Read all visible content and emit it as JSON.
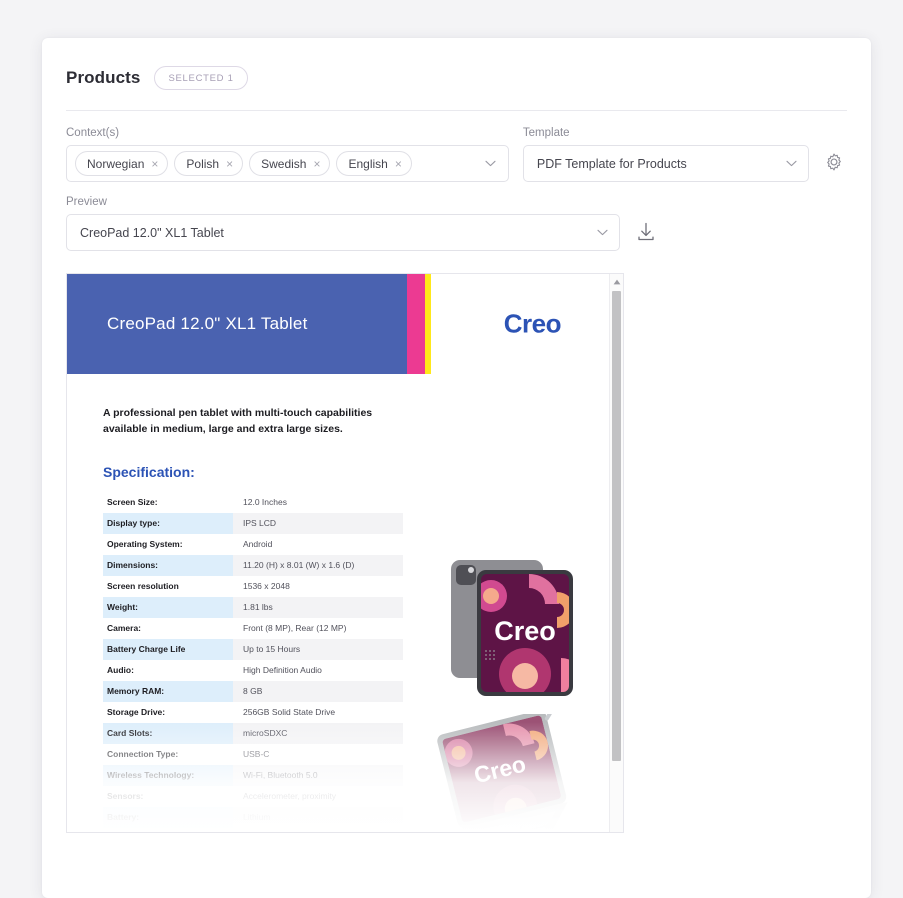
{
  "header": {
    "title": "Products",
    "badge": "SELECTED 1"
  },
  "form": {
    "contexts_label": "Context(s)",
    "context_chips": [
      {
        "label": "Norwegian",
        "remove_icon": "×"
      },
      {
        "label": "Polish",
        "remove_icon": "×"
      },
      {
        "label": "Swedish",
        "remove_icon": "×"
      },
      {
        "label": "English",
        "remove_icon": "×"
      }
    ],
    "template_label": "Template",
    "template_value": "PDF Template for Products",
    "preview_label": "Preview",
    "preview_value": "CreoPad 12.0\" XL1 Tablet"
  },
  "document": {
    "banner_title": "CreoPad 12.0\" XL1 Tablet",
    "brand": "Creo",
    "description": "A professional pen tablet with multi-touch capabilities available in medium, large and extra large sizes.",
    "spec_title": "Specification:",
    "specs": [
      {
        "key": "Screen Size:",
        "value": "12.0 Inches"
      },
      {
        "key": "Display type:",
        "value": "IPS LCD"
      },
      {
        "key": "Operating System:",
        "value": "Android"
      },
      {
        "key": "Dimensions:",
        "value": "11.20 (H) x 8.01 (W) x 1.6 (D)"
      },
      {
        "key": "Screen resolution",
        "value": "1536 x 2048"
      },
      {
        "key": "Weight:",
        "value": "1.81 lbs"
      },
      {
        "key": "Camera:",
        "value": "Front (8 MP), Rear (12 MP)"
      },
      {
        "key": "Battery Charge Life",
        "value": "Up to 15 Hours"
      },
      {
        "key": "Audio:",
        "value": "High Definition Audio"
      },
      {
        "key": "Memory RAM:",
        "value": "8 GB"
      },
      {
        "key": "Storage Drive:",
        "value": "256GB Solid State Drive"
      },
      {
        "key": "Card Slots:",
        "value": "microSDXC"
      },
      {
        "key": "Connection Type:",
        "value": "USB-C"
      },
      {
        "key": "Wireless Technology:",
        "value": "Wi-Fi, Bluetooth 5.0"
      },
      {
        "key": "Sensors:",
        "value": "Accelerometer, proximity"
      },
      {
        "key": "Battery:",
        "value": "Lithium"
      }
    ],
    "product_screen_text": "Creo"
  },
  "icons": {
    "chevron_down": "⌄",
    "scroll_up": "▲"
  },
  "colors": {
    "banner_blue": "#4a62b0",
    "stripe_pink": "#ec3a92",
    "stripe_yellow": "#ffe81a",
    "brand_blue": "#2c53b5",
    "row_key_bg": "#ddeefb",
    "row_value_bg": "#f3f3f5"
  }
}
